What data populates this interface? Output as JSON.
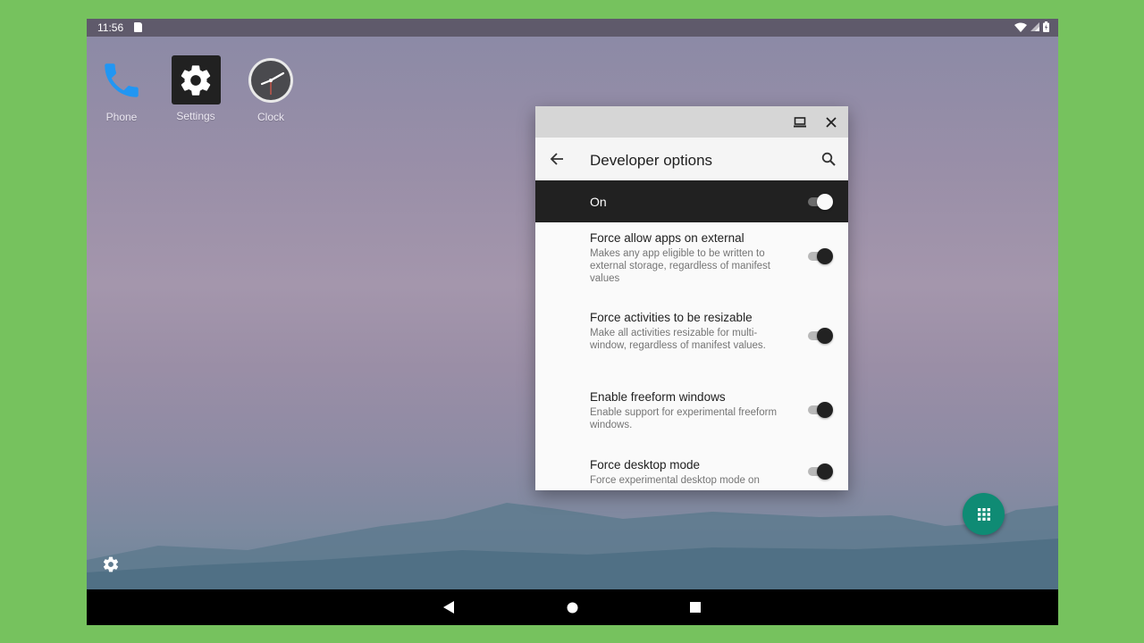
{
  "status_bar": {
    "time": "11:56"
  },
  "desktop": {
    "icons": [
      {
        "label": "Phone"
      },
      {
        "label": "Settings"
      },
      {
        "label": "Clock"
      }
    ]
  },
  "window": {
    "title": "Developer options",
    "master_switch": {
      "label": "On",
      "checked": true
    },
    "items": [
      {
        "title": "Force allow apps on external",
        "summary": "Makes any app eligible to be written to external storage, regardless of manifest values",
        "checked": true
      },
      {
        "title": "Force activities to be resizable",
        "summary": "Make all activities resizable for multi-window, regardless of manifest values.",
        "checked": true
      },
      {
        "title": "Enable freeform windows",
        "summary": "Enable support for experimental freeform windows.",
        "checked": true
      },
      {
        "title": "Force desktop mode",
        "summary": "Force experimental desktop mode on",
        "checked": true
      }
    ]
  },
  "colors": {
    "accent": "#0f8b74",
    "desktop_bg": "#76c25e",
    "master_bg": "#212121"
  }
}
